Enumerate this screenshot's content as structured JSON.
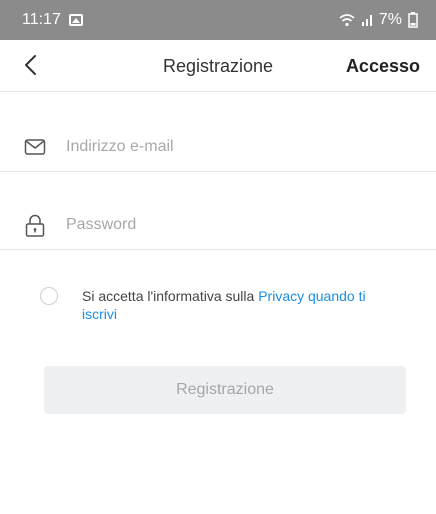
{
  "status_bar": {
    "time": "11:17",
    "battery": "7%",
    "icons": [
      "image-icon",
      "wifi-icon",
      "signal-icon",
      "battery-icon"
    ]
  },
  "header": {
    "title": "Registrazione",
    "login_link": "Accesso",
    "back_icon": "chevron-left-icon"
  },
  "form": {
    "email": {
      "placeholder": "Indirizzo e-mail",
      "value": "",
      "icon": "envelope-icon"
    },
    "password": {
      "placeholder": "Password",
      "value": "",
      "icon": "lock-icon"
    }
  },
  "consent": {
    "checked": false,
    "text_before": "Si accetta l'informativa sulla ",
    "link_text": "Privacy quando ti iscrivi"
  },
  "submit": {
    "label": "Registrazione",
    "enabled": false
  },
  "colors": {
    "link": "#1a8fe3",
    "status_bar": "#8b8b8b",
    "button_bg": "#eef0f2",
    "button_text": "#a3a7ab"
  }
}
